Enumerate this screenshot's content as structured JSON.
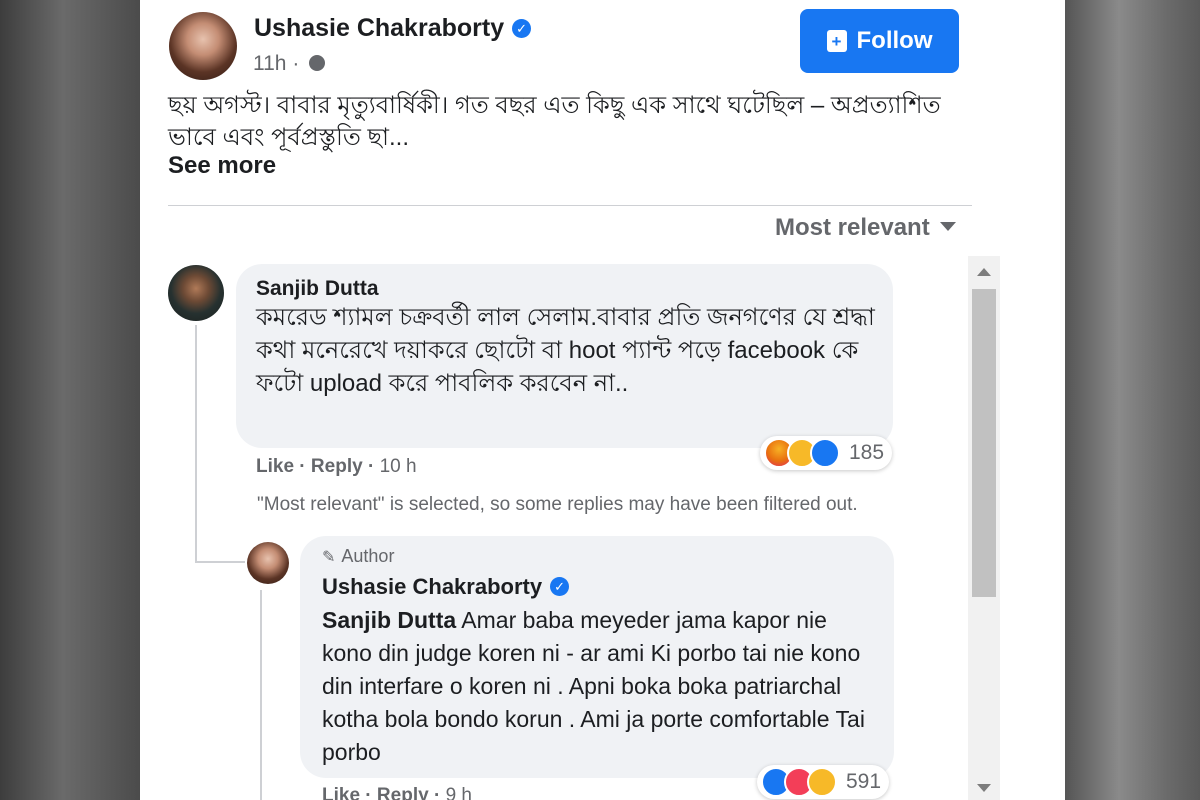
{
  "post": {
    "author": "Ushasie Chakraborty",
    "time": "11h",
    "follow_label": "Follow",
    "text": "ছয় অগস্ট। বাবার মৃত্যুবার্ষিকী। গত বছর এত কিছু এক সাথে ঘটেছিল – অপ্রত্যাশিত ভাবে এবং পূর্বপ্রস্তুতি ছা...",
    "see_more": "See more"
  },
  "comments_header": {
    "sort_label": "Most relevant"
  },
  "comment1": {
    "author": "Sanjib Dutta",
    "text": "কমরেড শ্যামল চক্রবর্তী লাল সেলাম.বাবার প্রতি জনগণের যে শ্রদ্ধা কথা মনেরেখে দয়াকরে ছোটো বা hoot প্যান্ট পড়ে facebook কে ফটো upload করে পাবলিক করবেন না..",
    "reaction_count": "185",
    "like": "Like",
    "reply": "Reply",
    "time": "10 h"
  },
  "filter_note": "\"Most relevant\" is selected, so some replies may have been filtered out.",
  "comment2": {
    "badge": "Author",
    "author": "Ushasie Chakraborty",
    "mention": "Sanjib Dutta",
    "text": " Amar baba meyeder jama kapor nie kono din judge koren ni - ar ami Ki porbo tai nie kono din interfare o koren ni . Apni boka boka patriarchal kotha bola bondo korun . Ami ja porte comfortable Tai porbo",
    "reaction_count": "591",
    "like": "Like",
    "reply": "Reply",
    "time": "9 h"
  },
  "colors": {
    "accent": "#1877f2",
    "bubble": "#f0f2f5",
    "muted": "#65676b"
  }
}
